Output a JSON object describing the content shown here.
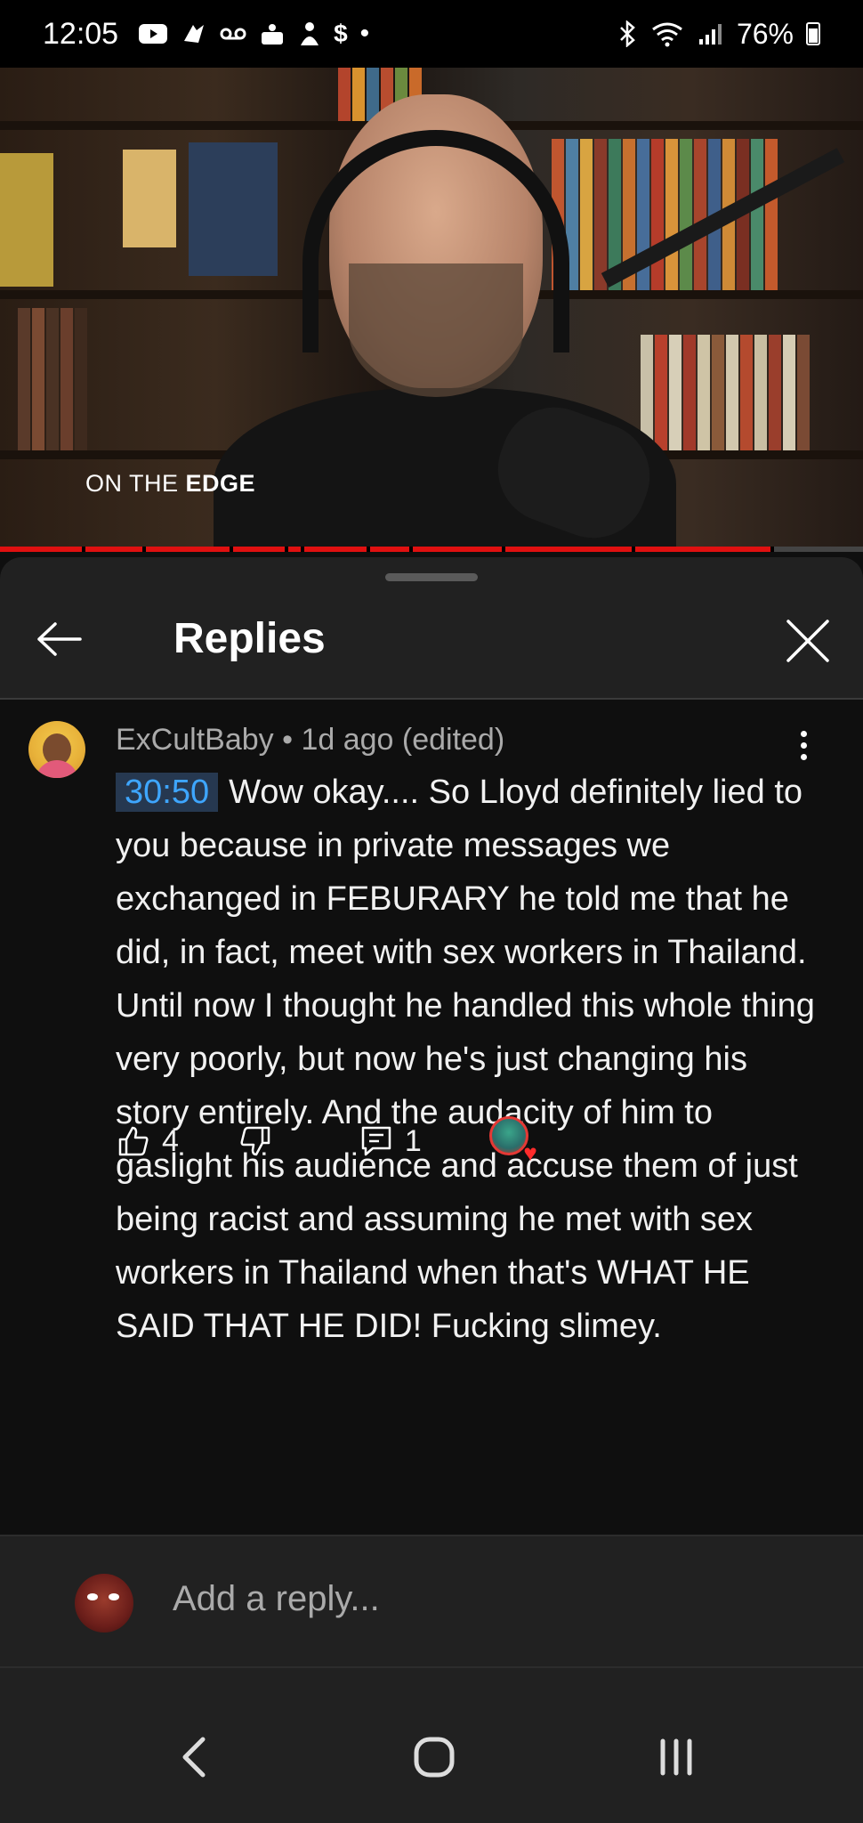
{
  "status_bar": {
    "time": "12:05",
    "battery": "76%",
    "left_icons": [
      "youtube-icon",
      "app-icon",
      "voicemail-icon",
      "cake-icon",
      "app-icon-2",
      "dollar-icon",
      "dot-icon"
    ],
    "right_icons": [
      "bluetooth-icon",
      "wifi-icon",
      "signal-icon",
      "battery-icon"
    ]
  },
  "video": {
    "caption_light": "ON THE ",
    "caption_bold": "EDGE",
    "progress": 0.895
  },
  "sheet": {
    "title": "Replies"
  },
  "comment": {
    "author": "ExCultBaby",
    "separator": " • ",
    "age": "1d ago (edited)",
    "timestamp": "30:50",
    "text": "Wow okay.... So Lloyd definitely lied to you because in private messages we exchanged in FEBURARY he told me that he did, in fact, meet with sex workers in Thailand. Until now I thought he handled this whole thing very poorly, but now he's just changing his story entirely. And the audacity of him to gaslight his audience and accuse them of just being racist and assuming he met with sex workers in Thailand when that's WHAT HE SAID THAT HE DID! Fucking slimey.",
    "likes": "4",
    "replies": "1"
  },
  "add_reply": {
    "placeholder": "Add a reply..."
  },
  "colors": {
    "accent_link": "#3ea6ff",
    "progress": "#e01010",
    "heart": "#ff2b2b"
  }
}
